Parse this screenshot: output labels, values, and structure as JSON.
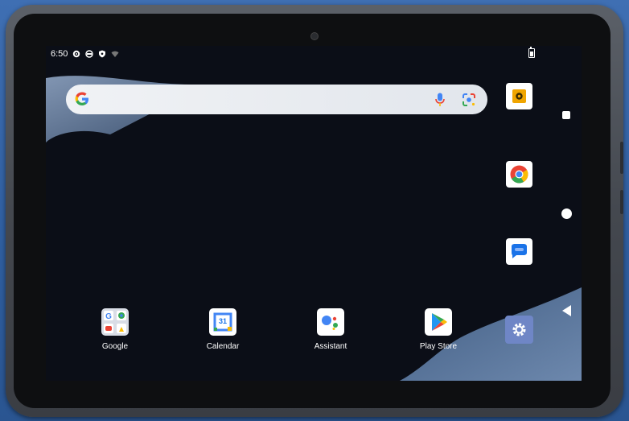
{
  "status_bar": {
    "time": "6:50",
    "icons": [
      "settings-gear-icon",
      "vpn-circle-icon",
      "shield-icon",
      "wifi-icon",
      "battery-icon"
    ]
  },
  "search_bar": {
    "logo": "google-g-icon",
    "mic": "mic-icon",
    "lens": "lens-icon"
  },
  "home_apps": [
    {
      "label": "Google",
      "icon": "google-folder-icon"
    },
    {
      "label": "Calendar",
      "icon": "calendar-icon",
      "day": "31"
    },
    {
      "label": "Assistant",
      "icon": "assistant-icon"
    },
    {
      "label": "Play Store",
      "icon": "play-store-icon"
    }
  ],
  "dock_apps": [
    "camera-icon",
    "chrome-icon",
    "messages-icon",
    "settings-icon"
  ],
  "nav_bar": [
    "recents-button",
    "home-button",
    "back-button"
  ],
  "colors": {
    "accent_blue": "#1a73e8",
    "search_bg": "#eceff3",
    "settings_bg": "#6f86c6"
  }
}
